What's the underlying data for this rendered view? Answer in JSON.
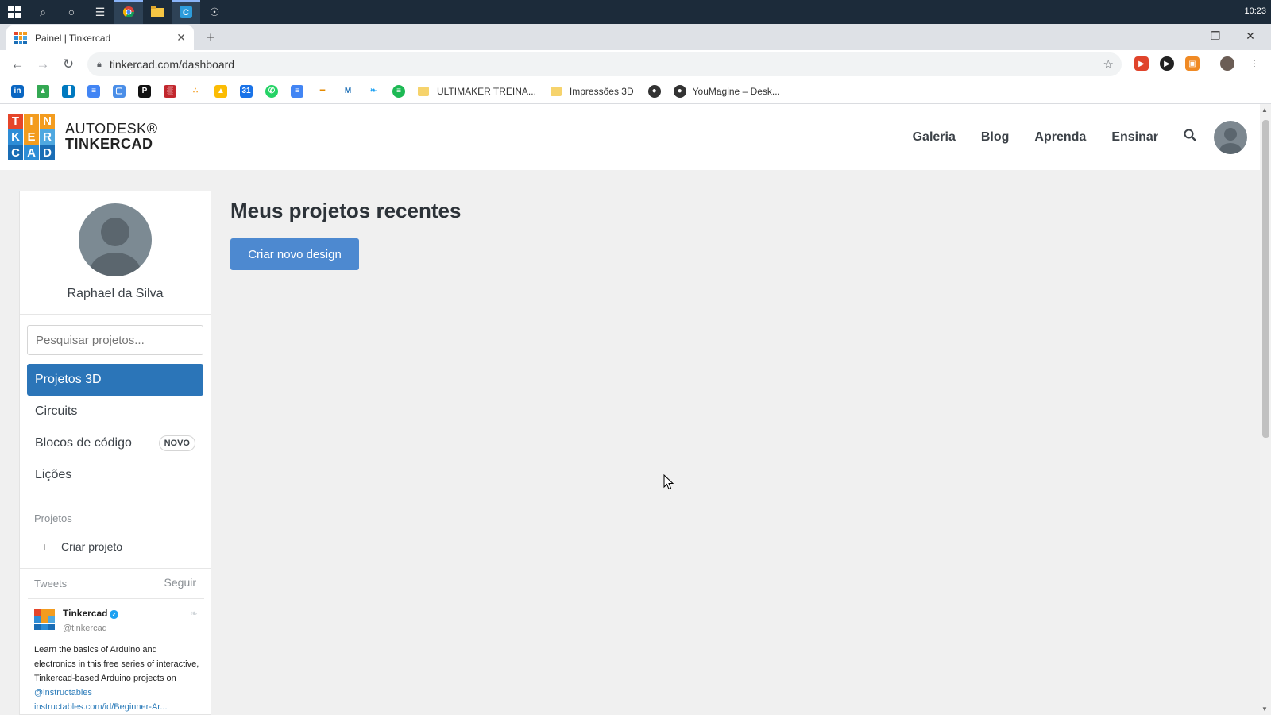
{
  "taskbar": {
    "clock": "10:23",
    "items": [
      "windows-start",
      "search",
      "cortana",
      "task-view",
      "chrome",
      "file-explorer",
      "app-c",
      "app-other"
    ]
  },
  "browser": {
    "tab_title": "Painel | Tinkercad",
    "url": "tinkercad.com/dashboard",
    "bookmarks": [
      {
        "type": "icon",
        "name": "bookmark-icon"
      },
      {
        "type": "folder",
        "label": "ULTIMAKER TREINA..."
      },
      {
        "type": "folder",
        "label": "Impressões 3D"
      },
      {
        "type": "site",
        "label": "YouMagine – Desk..."
      }
    ]
  },
  "site": {
    "brand_line1": "AUTODESK®",
    "brand_line2": "TINKERCAD",
    "logo_letters": [
      "T",
      "I",
      "N",
      "K",
      "E",
      "R",
      "C",
      "A",
      "D"
    ],
    "logo_colors": [
      "#e5452a",
      "#f39c1f",
      "#f39c1f",
      "#2e8dd6",
      "#f39c1f",
      "#4fa8e0",
      "#1a6db5",
      "#2e8dd6",
      "#1a6db5"
    ],
    "nav": {
      "gallery": "Galeria",
      "blog": "Blog",
      "learn": "Aprenda",
      "teach": "Ensinar"
    }
  },
  "sidebar": {
    "username": "Raphael da Silva",
    "search_placeholder": "Pesquisar projetos...",
    "menu": [
      {
        "label": "Projetos 3D",
        "active": true
      },
      {
        "label": "Circuits"
      },
      {
        "label": "Blocos de código",
        "badge": "NOVO"
      },
      {
        "label": "Lições"
      }
    ],
    "projects_heading": "Projetos",
    "create_project": "Criar projeto",
    "tweets_heading": "Tweets",
    "follow": "Seguir",
    "tweet": {
      "name": "Tinkercad",
      "handle": "@tinkercad",
      "text": "Learn the basics of Arduino and electronics in this free series of interactive, Tinkercad-based Arduino projects on",
      "mention": "@instructables",
      "link": "instructables.com/id/Beginner-Ar..."
    }
  },
  "main": {
    "title": "Meus projetos recentes",
    "create_button": "Criar novo design"
  },
  "colors": {
    "accent": "#2b75b8",
    "button": "#4d89d0"
  }
}
